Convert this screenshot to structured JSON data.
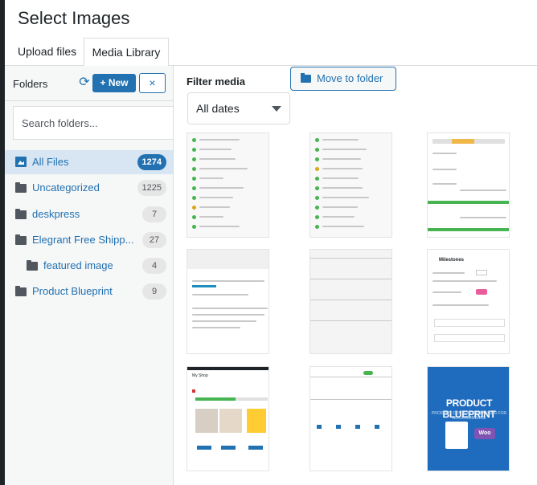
{
  "modal": {
    "title": "Select Images"
  },
  "tabs": [
    {
      "label": "Upload files"
    },
    {
      "label": "Media Library",
      "active": true
    }
  ],
  "sidebar": {
    "label": "Folders",
    "new_button": "+ New",
    "close_button": "×",
    "search_placeholder": "Search folders...",
    "folders": [
      {
        "name": "All Files",
        "count": "1274",
        "active": true,
        "icon": "image-icon"
      },
      {
        "name": "Uncategorized",
        "count": "1225",
        "icon": "folder-icon"
      },
      {
        "name": "deskpress",
        "count": "7",
        "icon": "folder-icon"
      },
      {
        "name": "Elegrant Free Shipp...",
        "count": "27",
        "icon": "folder-icon"
      },
      {
        "name": "featured image",
        "count": "4",
        "icon": "folder-icon"
      },
      {
        "name": "Product Blueprint",
        "count": "9",
        "icon": "folder-icon"
      }
    ]
  },
  "main": {
    "filter_label": "Filter media",
    "date_filter": "All dates",
    "move_button": "Move to folder",
    "thumb_text": {
      "milestone": "Milestones",
      "product_blueprint": "PRODUCT BLUEPRINT",
      "blueprint_sub": "PRODUCT CONTENT ORGANIZER FOR WOOCOMMERCE",
      "woo": "Woo",
      "my_shop": "My Shop"
    }
  },
  "colors": {
    "accent": "#2271b1",
    "active_bg": "#d8e6f3",
    "success": "#46b450"
  }
}
